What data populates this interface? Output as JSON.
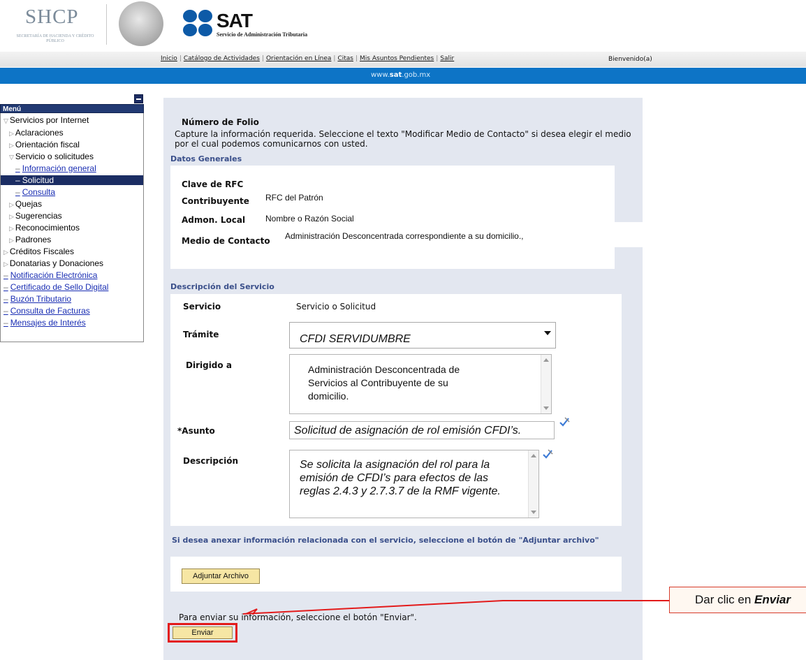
{
  "header": {
    "shcp_title": "SHCP",
    "shcp_subtitle": "SECRETARÍA DE HACIENDA Y CRÉDITO PÚBLICO",
    "sat_word": "SAT",
    "sat_subtitle": "Servicio de Administración Tributaria"
  },
  "nav": {
    "links": [
      "Inicio",
      "Catálogo de Actividades",
      "Orientación en Línea",
      "Citas",
      "Mis Asuntos Pendientes",
      "Salir"
    ],
    "welcome": "Bienvenido(a)"
  },
  "band": {
    "url_prefix": "www.",
    "url_bold": "sat",
    "url_suffix": ".gob.mx"
  },
  "sidebar": {
    "menu_title": "Menú",
    "items": [
      "Servicios por Internet",
      "Aclaraciones",
      "Orientación fiscal",
      "Servicio o solicitudes",
      "Información general",
      "Solicitud",
      "Consulta",
      "Quejas",
      "Sugerencias",
      "Reconocimientos",
      "Padrones",
      "Créditos Fiscales",
      "Donatarias y Donaciones",
      "Notificación Electrónica",
      "Certificado de Sello Digital",
      "Buzón Tributario",
      "Consulta de Facturas",
      "Mensajes de Interés"
    ]
  },
  "form": {
    "folio_title": "Número de Folio",
    "instructions": "Capture la información requerida. Seleccione el texto \"Modificar Medio de Contacto\" si desea elegir el medio por el cual podemos comunicarnos con usted.",
    "general_section": "Datos Generales",
    "rfc_label": "Clave de RFC",
    "contribuyente_label": "Contribuyente",
    "contribuyente_value": "RFC del Patrón",
    "admon_label": "Admon. Local",
    "admon_value": "Nombre o Razón Social",
    "medio_label": "Medio de Contacto",
    "medio_value": "Administración Desconcentrada  correspondiente a su domicilio.,",
    "service_section": "Descripción del Servicio",
    "servicio_label": "Servicio",
    "servicio_value": "Servicio o Solicitud",
    "tramite_label": "Trámite",
    "tramite_value": "CFDI SERVIDUMBRE",
    "dirigido_label": "Dirigido a",
    "dirigido_value": "Administración Desconcentrada de Servicios al Contribuyente de su domicilio.",
    "asunto_label": "*Asunto",
    "asunto_value": "Solicitud de asignación de rol emisión CFDI’s.",
    "descripcion_label": "Descripción",
    "descripcion_value": "Se solicita la asignación del rol para la emisión de CFDI’s para efectos de las reglas 2.4.3 y 2.7.3.7 de la RMF vigente.",
    "attach_text": "Si desea anexar información relacionada con el servicio, seleccione el botón de \"Adjuntar archivo\"",
    "attach_button": "Adjuntar Archivo",
    "send_text": "Para enviar su información, seleccione el botón \"Enviar\".",
    "send_button": "Enviar"
  },
  "callout": {
    "prefix": "Dar clic en ",
    "emphasis": "Enviar"
  },
  "colors": {
    "band_blue": "#0d74c6",
    "menu_navy": "#223a73",
    "panel_bg": "#e3e7f0",
    "button_yellow": "#f6e6a4",
    "callout_red": "#e31b1b"
  }
}
